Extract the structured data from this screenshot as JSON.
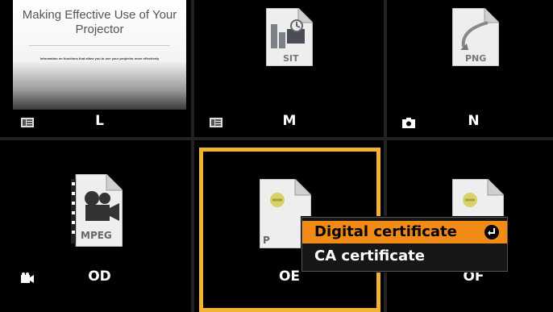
{
  "grid": {
    "items": [
      {
        "id": "L",
        "label": "L",
        "type": "presentation",
        "icon": "presentation-icon"
      },
      {
        "id": "M",
        "label": "M",
        "type": "sit",
        "icon": "presentation-icon",
        "file_tag": "SIT"
      },
      {
        "id": "N",
        "label": "N",
        "type": "png",
        "icon": "camera-icon",
        "file_tag": "PNG"
      },
      {
        "id": "OD",
        "label": "OD",
        "type": "mpeg",
        "icon": "video-camera-icon",
        "file_tag": "MPEG"
      },
      {
        "id": "OE",
        "label": "OE",
        "type": "certificate",
        "icon": "",
        "file_tag": "P"
      },
      {
        "id": "OF",
        "label": "OF",
        "type": "certificate",
        "icon": ""
      }
    ],
    "selected": "OE"
  },
  "thumbnail_L": {
    "title": "Making Effective Use of Your Projector",
    "body": "Information on functions that allow you to use your projector more effectively"
  },
  "context_menu": {
    "items": [
      {
        "label": "Digital certificate",
        "highlighted": true,
        "icon": "enter-icon"
      },
      {
        "label": "CA certificate",
        "highlighted": false
      }
    ]
  },
  "colors": {
    "background": "#000000",
    "selection": "#f2b233",
    "menu_highlight": "#f28a16"
  }
}
